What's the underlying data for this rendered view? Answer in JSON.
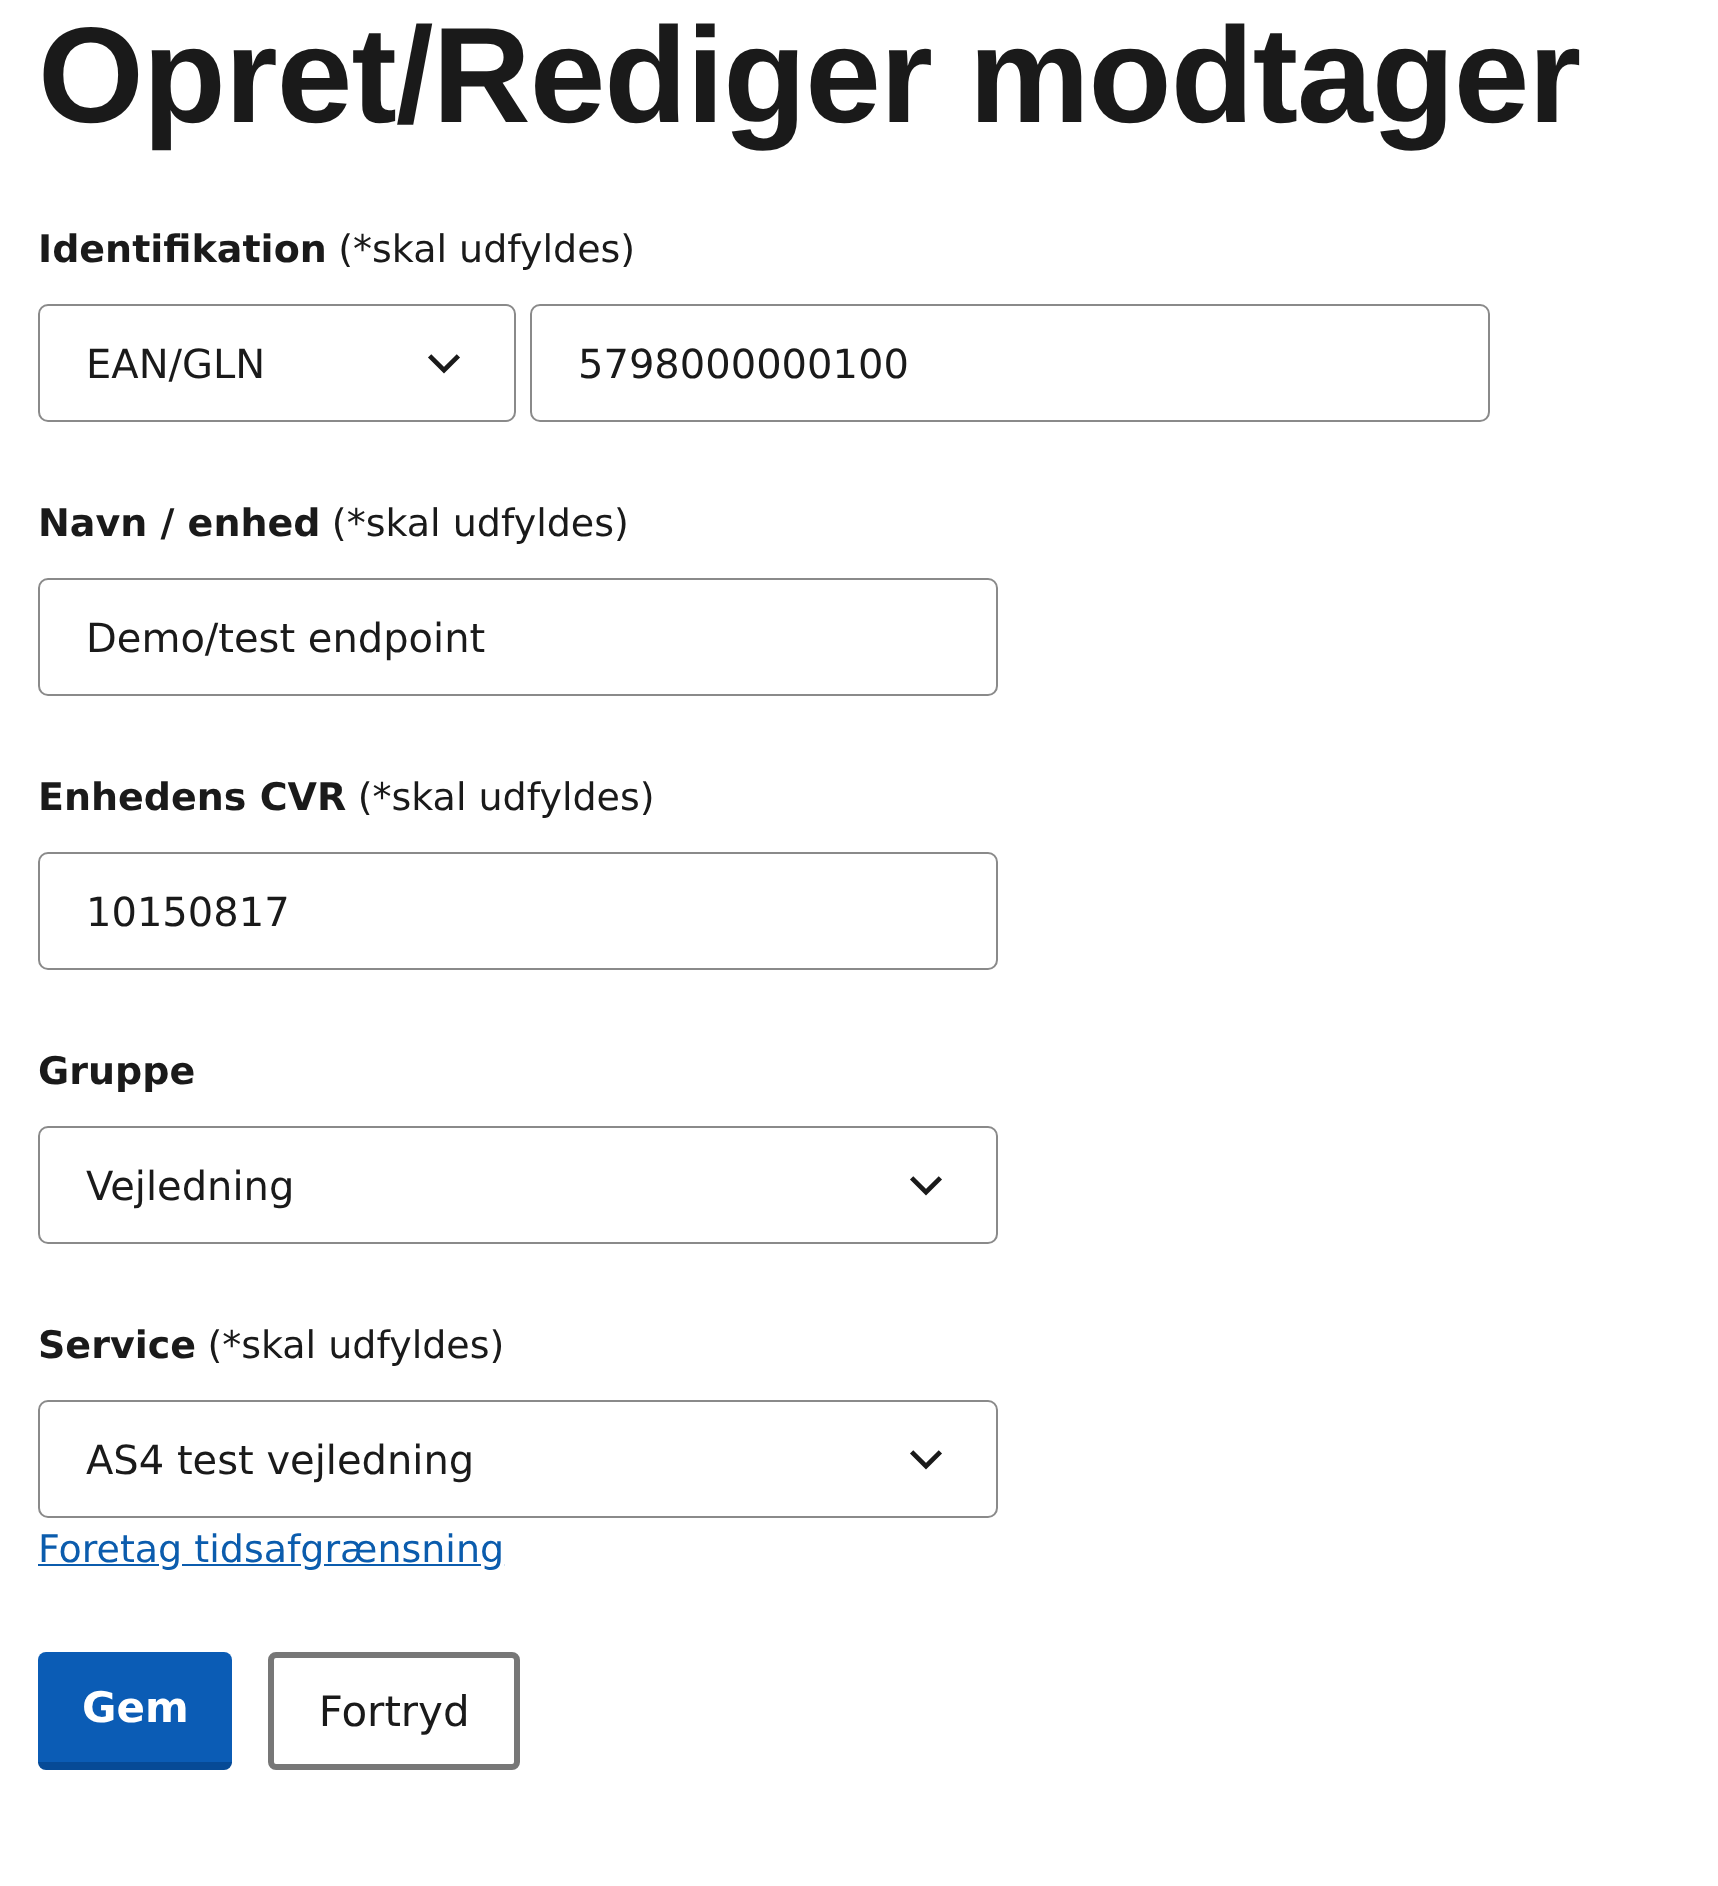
{
  "title": "Opret/Rediger modtager",
  "fields": [
    {
      "kind": "pair",
      "label": "Identifikation",
      "note": "(*skal udfyldes)",
      "select": "EAN/GLN",
      "value": "5798000000100"
    },
    {
      "kind": "input",
      "label": "Navn / enhed",
      "note": "(*skal udfyldes)",
      "value": "Demo/test endpoint"
    },
    {
      "kind": "input",
      "label": "Enhedens CVR",
      "note": "(*skal udfyldes)",
      "value": "10150817"
    },
    {
      "kind": "select",
      "label": "Gruppe",
      "value": "Vejledning"
    },
    {
      "kind": "select",
      "label": "Service",
      "note": "(*skal udfyldes)",
      "value": "AS4 test vejledning",
      "link": "Foretag tidsafgrænsning"
    }
  ],
  "buttons": [
    {
      "label": "Gem",
      "kind": "primary"
    },
    {
      "label": "Fortryd",
      "kind": "secondary"
    }
  ]
}
